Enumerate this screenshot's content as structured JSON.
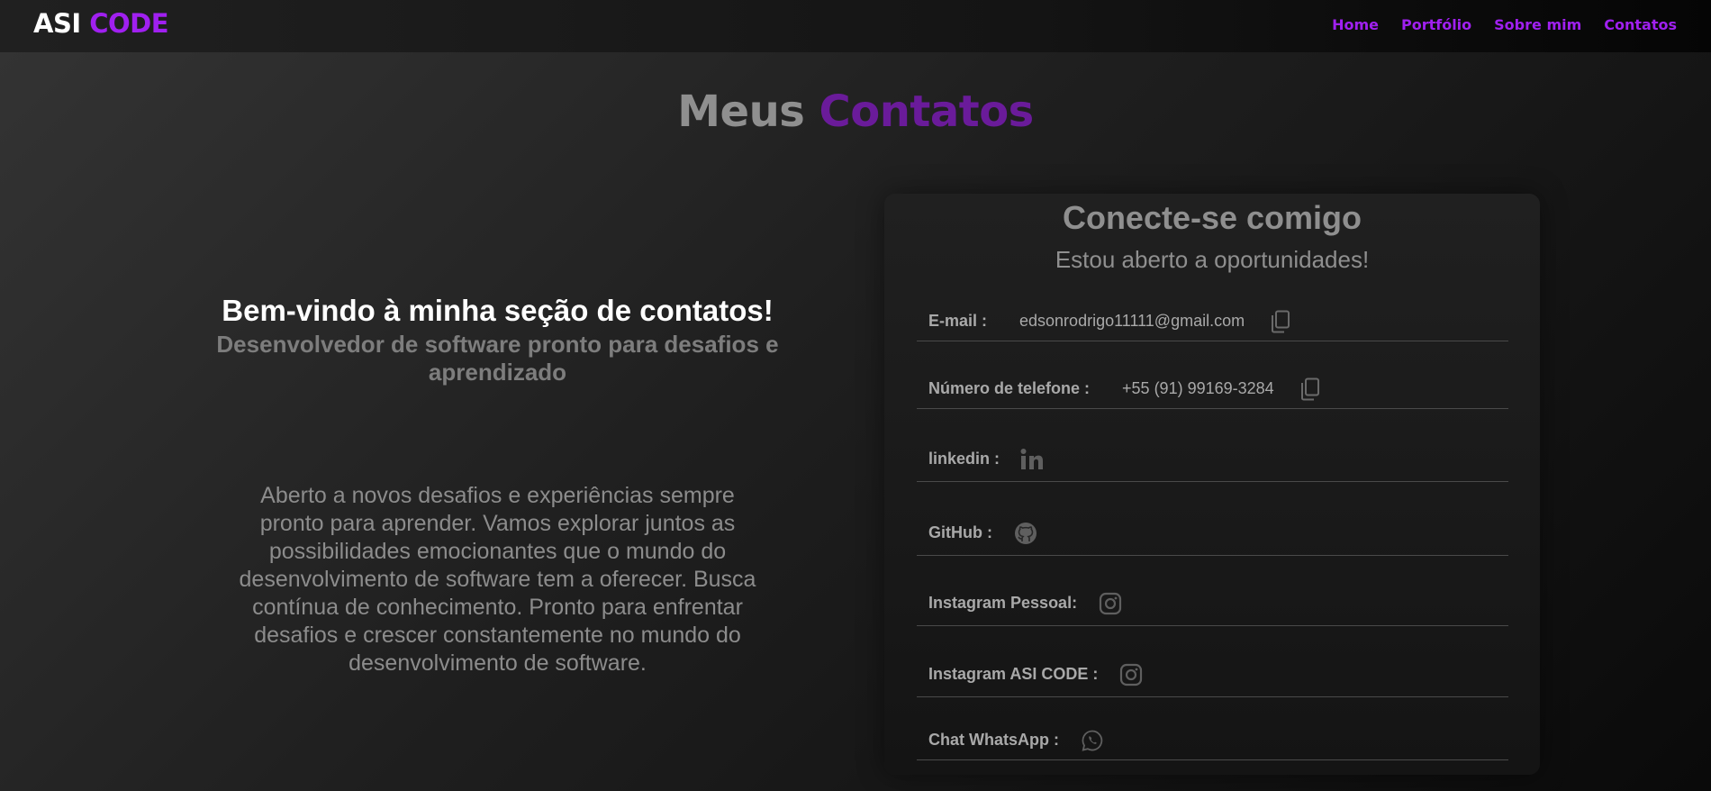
{
  "header": {
    "logo_part1": "ASI",
    "logo_part2": "CODE",
    "nav": [
      "Home",
      "Portfólio",
      "Sobre mim",
      "Contatos"
    ]
  },
  "page_title": {
    "part1": "Meus",
    "part2": "Contatos"
  },
  "left": {
    "welcome": "Bem-vindo à minha seção de contatos!",
    "subtitle": "Desenvolvedor de software pronto para desafios e aprendizado",
    "description": "Aberto a novos desafios e experiências sempre pronto para aprender. Vamos explorar juntos as possibilidades emocionantes que o mundo do desenvolvimento de software tem a oferecer. Busca contínua de conhecimento. Pronto para enfrentar desafios e crescer constantemente no mundo do desenvolvimento de software."
  },
  "card": {
    "title": "Conecte-se comigo",
    "subtitle": "Estou aberto a oportunidades!",
    "rows": [
      {
        "label": "E-mail :",
        "value": "edsonrodrigo11111@gmail.com",
        "icon": "copy-icon"
      },
      {
        "label": "Número de telefone :",
        "value": "+55 (91) 99169-3284",
        "icon": "copy-icon"
      },
      {
        "label": "linkedin :",
        "icon": "linkedin-icon"
      },
      {
        "label": "GitHub :",
        "icon": "github-icon"
      },
      {
        "label": "Instagram Pessoal:",
        "icon": "instagram-icon"
      },
      {
        "label": "Instagram ASI CODE :",
        "icon": "instagram-icon"
      },
      {
        "label": "Chat WhatsApp :",
        "icon": "whatsapp-icon"
      }
    ]
  },
  "colors": {
    "accent": "#a020f0",
    "title_accent": "#6a1b9a",
    "muted": "#8f8f8f"
  }
}
